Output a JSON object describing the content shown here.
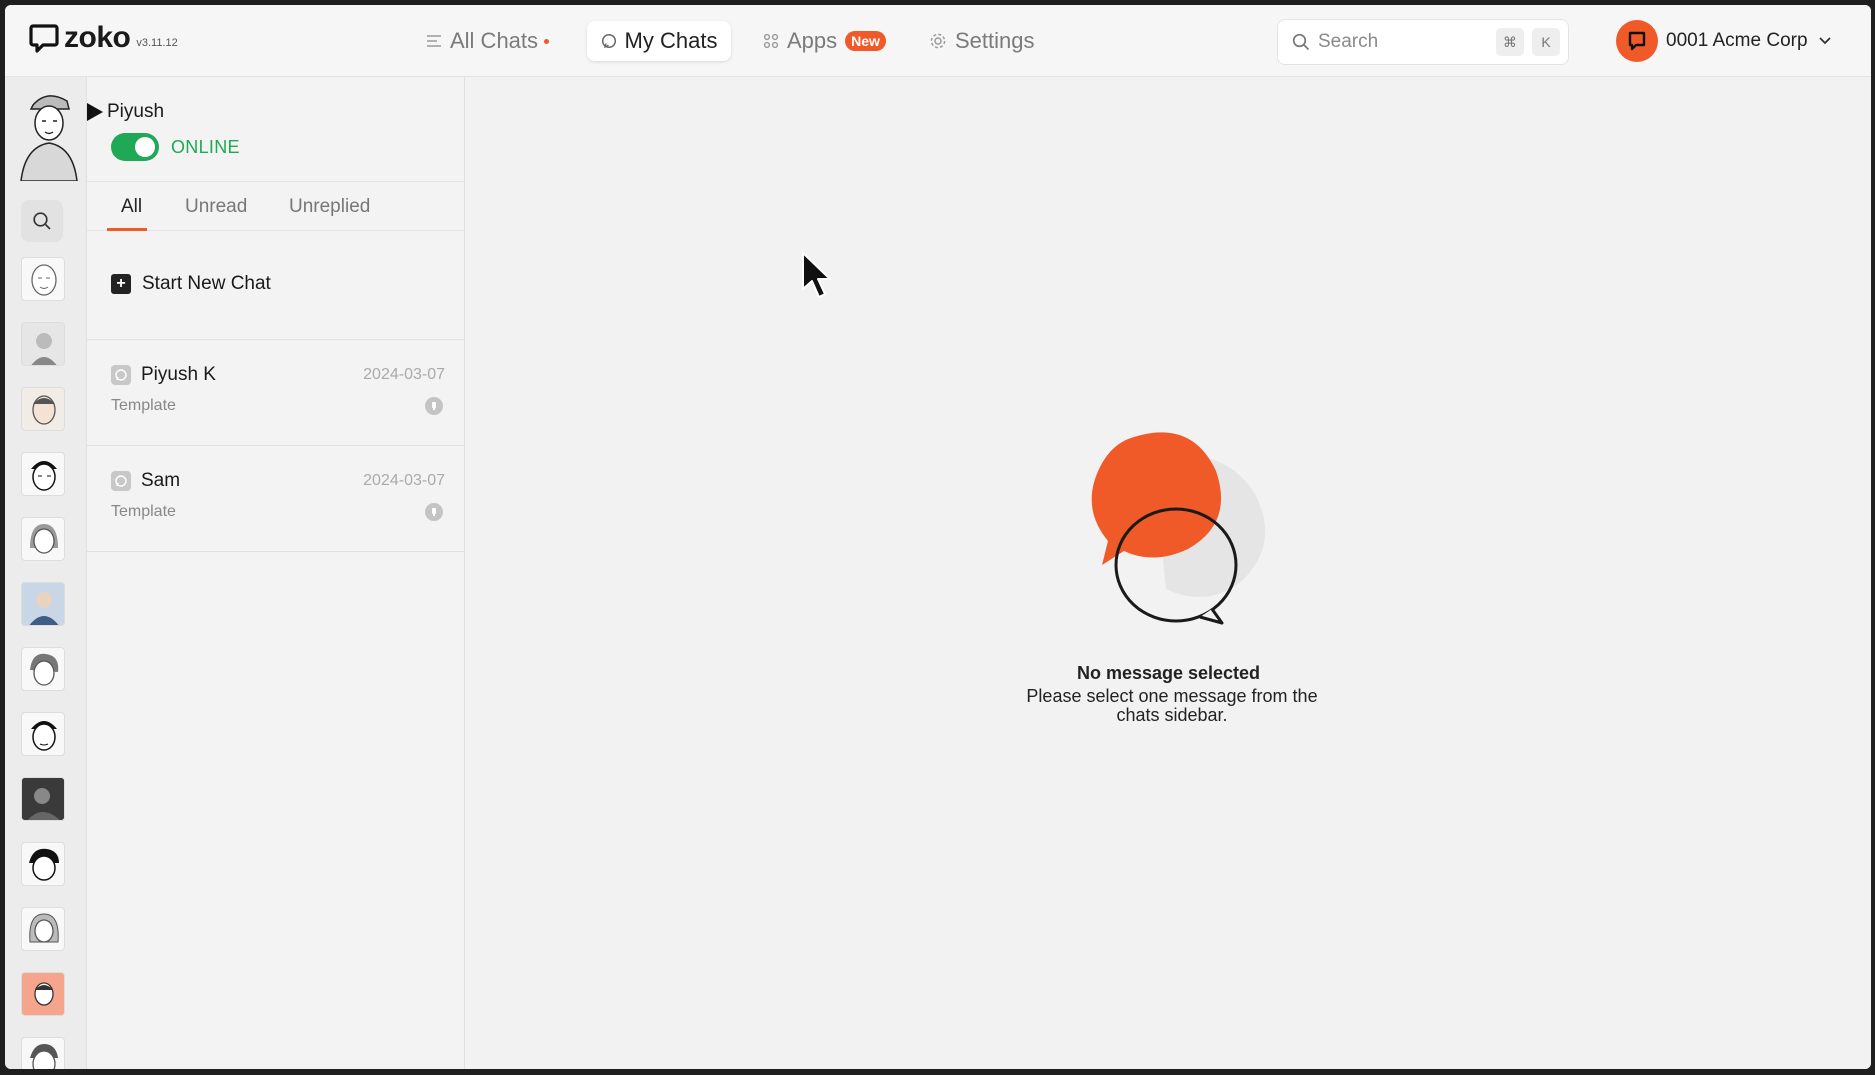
{
  "app": {
    "name": "zoko",
    "version": "v3.11.12"
  },
  "nav": {
    "all_chats": "All Chats",
    "my_chats": "My Chats",
    "apps": "Apps",
    "apps_badge": "New",
    "settings": "Settings"
  },
  "search": {
    "placeholder": "Search",
    "shortcut_mod": "⌘",
    "shortcut_key": "K"
  },
  "org": {
    "name": "0001 Acme Corp"
  },
  "user": {
    "name": "Piyush",
    "status": "ONLINE",
    "online": true
  },
  "tabs": {
    "all": "All",
    "unread": "Unread",
    "unreplied": "Unreplied",
    "active": "All"
  },
  "actions": {
    "start_new_chat": "Start New Chat"
  },
  "chats": [
    {
      "name": "Piyush K",
      "date": "2024-03-07",
      "preview": "Template"
    },
    {
      "name": "Sam",
      "date": "2024-03-07",
      "preview": "Template"
    }
  ],
  "empty_state": {
    "title": "No message selected",
    "subtitle": "Please select one message from the chats sidebar."
  },
  "colors": {
    "accent": "#f05a28",
    "online": "#1fa855"
  },
  "rail": {
    "contact_avatars": [
      "avatar-1",
      "avatar-2",
      "avatar-3",
      "avatar-4",
      "avatar-5",
      "avatar-6",
      "avatar-7",
      "avatar-8",
      "avatar-9",
      "avatar-10",
      "avatar-11",
      "avatar-12",
      "avatar-13"
    ]
  }
}
